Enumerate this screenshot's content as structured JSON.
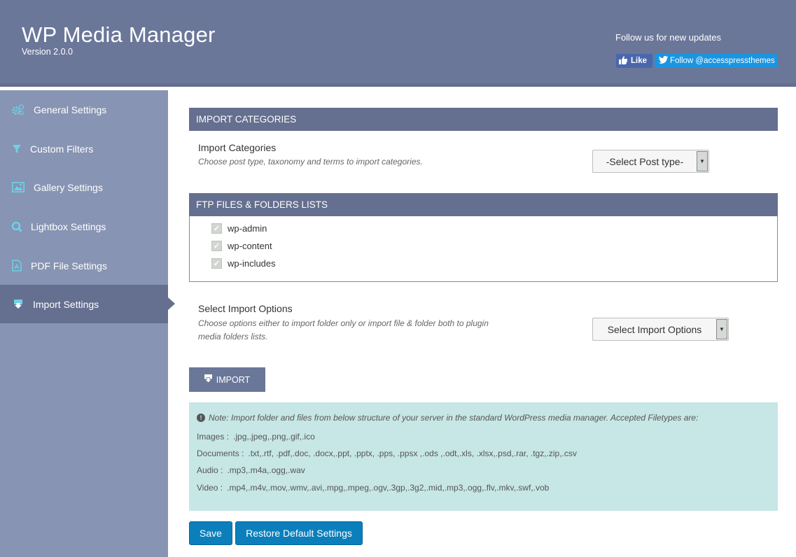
{
  "header": {
    "title": "WP Media Manager",
    "version": "Version 2.0.0",
    "follow_text": "Follow us for new updates",
    "like_label": "Like",
    "twitter_label": "Follow @accesspressthemes"
  },
  "sidebar": {
    "active_index": 5,
    "items": [
      {
        "label": "General Settings",
        "icon": "gears-icon"
      },
      {
        "label": "Custom Filters",
        "icon": "filter-icon"
      },
      {
        "label": "Gallery Settings",
        "icon": "image-icon"
      },
      {
        "label": "Lightbox Settings",
        "icon": "search-icon"
      },
      {
        "label": "PDF File Settings",
        "icon": "pdf-file-icon"
      },
      {
        "label": "Import Settings",
        "icon": "import-icon"
      }
    ]
  },
  "import_categories": {
    "section_title": "IMPORT CATEGORIES",
    "label": "Import Categories",
    "description": "Choose post type, taxonomy and terms to import categories.",
    "select_value": "-Select Post type-"
  },
  "ftp": {
    "section_title": "FTP FILES & FOLDERS LISTS",
    "items": [
      {
        "label": "wp-admin",
        "checked": true
      },
      {
        "label": "wp-content",
        "checked": true
      },
      {
        "label": "wp-includes",
        "checked": true
      }
    ]
  },
  "import_options": {
    "label": "Select Import Options",
    "description_line1": "Choose options either to import folder only or import file & folder both to plugin",
    "description_line2": "media folders lists.",
    "select_value": "Select Import Options"
  },
  "import_button": "IMPORT",
  "note": {
    "text": "Note: Import folder and files from below structure of your server in the standard WordPress media manager. Accepted Filetypes are:",
    "filetypes": [
      {
        "label": "Images :",
        "value": ".jpg,.jpeg,.png,.gif,.ico"
      },
      {
        "label": "Documents :",
        "value": ".txt,.rtf, .pdf,.doc, .docx,.ppt, .pptx, .pps, .ppsx ,.ods ,.odt,.xls, .xlsx,.psd,.rar, .tgz,.zip,.csv"
      },
      {
        "label": "Audio :",
        "value": ".mp3,.m4a,.ogg,.wav"
      },
      {
        "label": "Video :",
        "value": ".mp4,.m4v,.mov,.wmv,.avi,.mpg,.mpeg,.ogv,.3gp,.3g2,.mid,.mp3,.ogg,.flv,.mkv,.swf,.vob"
      }
    ]
  },
  "buttons": {
    "save": "Save",
    "restore": "Restore Default Settings"
  },
  "colors": {
    "header_bg": "#6b7799",
    "sidebar_bg": "#8794b3",
    "active_bg": "#656f8f",
    "icon_accent": "#6dd2e8",
    "note_bg": "#c7e6e6",
    "primary_button": "#0b7fbb"
  }
}
